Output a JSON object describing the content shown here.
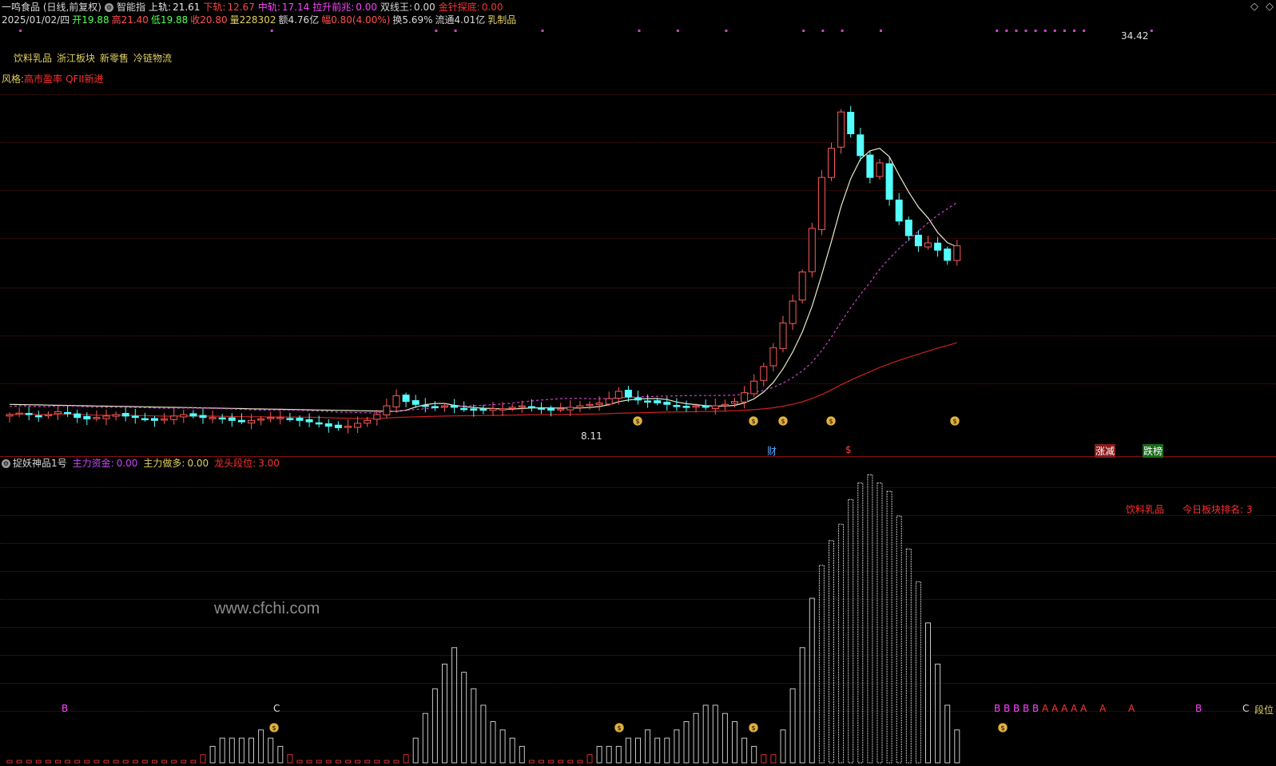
{
  "colors": {
    "bg": "#000000",
    "up": "#ff5a5a",
    "down": "#55ffff",
    "ma_white": "#e8e8c8",
    "ma_purple": "#cc44cc",
    "ma_red": "#cc2222",
    "yellow": "#e0d060",
    "magenta": "#ff44ff",
    "grid": "#5a1414"
  },
  "header": {
    "title": "一鸣食品 (日线,前复权)",
    "indicator_name": "智能指",
    "upper_label": "上轨:",
    "upper_value": "21.61",
    "lower_label": "下轨:",
    "lower_value": "12.67",
    "mid_label": "中轨:",
    "mid_value": "17.14",
    "pull_label": "拉升前兆:",
    "pull_value": "0.00",
    "dual_label": "双线王:",
    "dual_value": "0.00",
    "needle_label": "金针探底:",
    "needle_value": "0.00"
  },
  "quote": {
    "date": "2025/01/02/四",
    "open": "开19.88",
    "high": "高21.40",
    "low": "低19.88",
    "close": "收20.80",
    "volume": "量228302",
    "amount": "额4.76亿",
    "change": "幅0.80(4.00%)",
    "turnover": "换5.69%",
    "float_value": "流通4.01亿",
    "category": "乳制品"
  },
  "sectors": [
    "饮料乳品",
    "浙江板块",
    "新零售",
    "冷链物流"
  ],
  "style": {
    "label": "风格:",
    "tags": [
      "高市盈率",
      "QFII新进"
    ]
  },
  "price_marks": {
    "high": "34.42",
    "low": "8.11"
  },
  "event_labels": {
    "cai": "财",
    "dollar": "$",
    "zhangjian": "涨减",
    "diebang": "跌榜"
  },
  "lower_panel": {
    "name": "捉妖神品1号",
    "main_fund_label": "主力资金:",
    "main_fund_value": "0.00",
    "main_long_label": "主力做多:",
    "main_long_value": "0.00",
    "dragon_label": "龙头段位:",
    "dragon_value": "3.00",
    "sector_name": "饮料乳品",
    "rank_text": "今日板块排名: 3",
    "segment_label": "段位"
  },
  "signals": {
    "b": "B",
    "c": "C",
    "a": "A"
  },
  "watermark": "www.cfchi.com",
  "icons": {
    "diamond": "◇",
    "chevron": "◇",
    "moneybag": "money-bag-icon",
    "gear": "gear-icon"
  },
  "chart_data": [
    {
      "type": "candlestick",
      "title": "一鸣食品 (日线,前复权)",
      "y_range_approx": [
        8.11,
        34.42
      ],
      "series": [
        {
          "name": "上轨",
          "last": 21.61
        },
        {
          "name": "下轨",
          "last": 12.67
        },
        {
          "name": "中轨",
          "last": 17.14
        }
      ],
      "close_approx": [
        9.2,
        9.3,
        9.2,
        9.1,
        9.2,
        9.4,
        9.3,
        9.0,
        8.9,
        9.0,
        9.1,
        9.2,
        9.1,
        9.0,
        8.9,
        8.8,
        8.9,
        9.1,
        9.2,
        9.1,
        9.0,
        9.0,
        8.9,
        8.8,
        8.7,
        8.8,
        8.9,
        9.0,
        9.0,
        8.9,
        8.8,
        8.7,
        8.6,
        8.4,
        8.3,
        8.4,
        8.6,
        8.8,
        9.2,
        9.8,
        10.5,
        10.1,
        9.9,
        9.8,
        9.7,
        9.8,
        9.7,
        9.6,
        9.5,
        9.5,
        9.6,
        9.6,
        9.7,
        9.8,
        9.7,
        9.6,
        9.5,
        9.6,
        9.7,
        9.8,
        9.9,
        10.0,
        10.3,
        10.8,
        10.4,
        10.2,
        10.1,
        10.0,
        9.9,
        9.8,
        9.7,
        9.8,
        9.7,
        9.8,
        9.9,
        10.1,
        10.7,
        11.5,
        12.5,
        13.8,
        15.5,
        17.0,
        19.0,
        22.0,
        25.5,
        27.5,
        30.0,
        28.5,
        27.0,
        25.5,
        26.5,
        24.0,
        22.5,
        21.5,
        20.8,
        21.0,
        20.5,
        19.8,
        20.8
      ]
    },
    {
      "type": "bar",
      "title": "捉妖神品1号",
      "series": [
        {
          "name": "主力资金",
          "values_approx": [
            0,
            0,
            0,
            0,
            0,
            0,
            0,
            0,
            0,
            0,
            0,
            0,
            0,
            0,
            0,
            0,
            0,
            0,
            0,
            0,
            1,
            2,
            3,
            3,
            3,
            3,
            4,
            3,
            2,
            1,
            0,
            0,
            0,
            0,
            0,
            0,
            0,
            0,
            0,
            0,
            0,
            1,
            3,
            6,
            9,
            12,
            14,
            11,
            9,
            7,
            5,
            4,
            3,
            2,
            0,
            0,
            0,
            0,
            0,
            0,
            1,
            2,
            2,
            2,
            3,
            3,
            4,
            3,
            3,
            4,
            5,
            6,
            7,
            7,
            6,
            5,
            3,
            2,
            1,
            1,
            4,
            9,
            14,
            20,
            24,
            27,
            29,
            32,
            34,
            35,
            34,
            33,
            30,
            26,
            22,
            17,
            12,
            7,
            4
          ]
        }
      ]
    }
  ]
}
